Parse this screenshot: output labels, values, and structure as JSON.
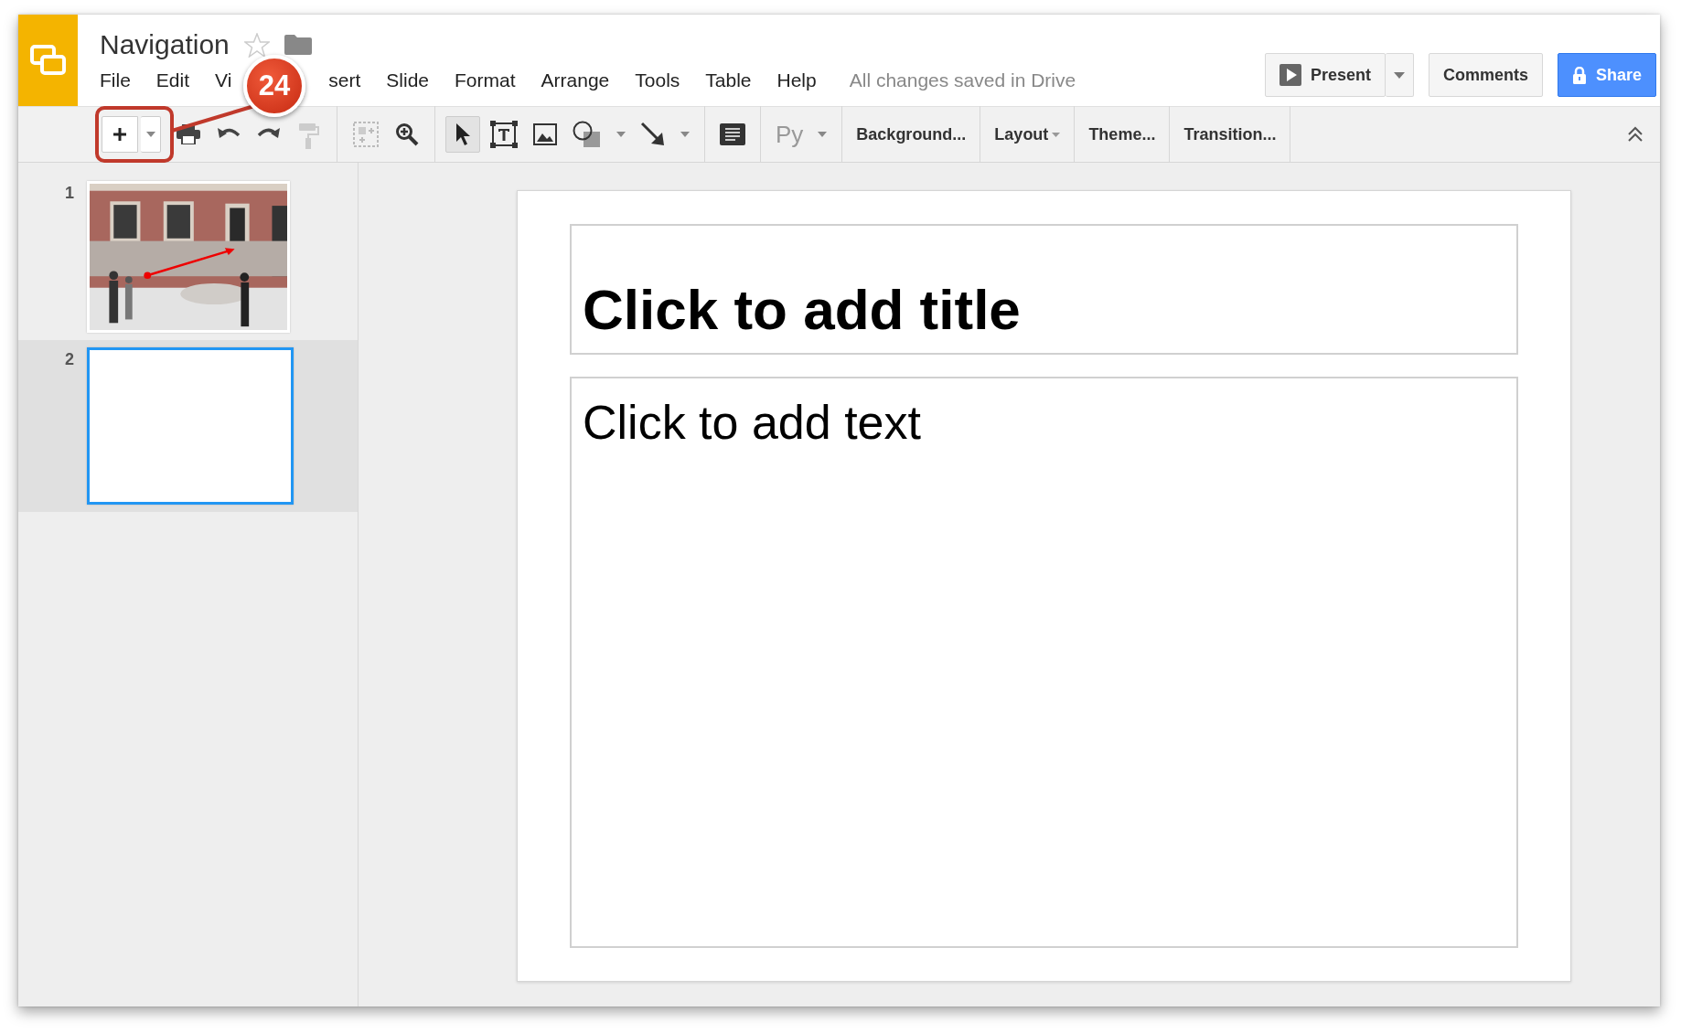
{
  "app": {
    "title": "Navigation"
  },
  "menu": [
    {
      "label": "File"
    },
    {
      "label": "Edit"
    },
    {
      "label": "Vi"
    },
    {
      "label": "sert"
    },
    {
      "label": "Slide"
    },
    {
      "label": "Format"
    },
    {
      "label": "Arrange"
    },
    {
      "label": "Tools"
    },
    {
      "label": "Table"
    },
    {
      "label": "Help"
    }
  ],
  "save_status": "All changes saved in Drive",
  "header_buttons": {
    "present": "Present",
    "comments": "Comments",
    "share": "Share"
  },
  "toolbar": {
    "input_tools": "Py",
    "text_buttons": [
      {
        "label": "Background...",
        "kind": "plain"
      },
      {
        "label": "Layout",
        "kind": "dropdown"
      },
      {
        "label": "Theme...",
        "kind": "plain"
      },
      {
        "label": "Transition...",
        "kind": "plain"
      }
    ]
  },
  "slides": [
    {
      "number": "1",
      "kind": "picture",
      "selected": false
    },
    {
      "number": "2",
      "kind": "blank",
      "selected": true
    }
  ],
  "canvas": {
    "title_placeholder": "Click to add title",
    "body_placeholder": "Click to add text"
  },
  "callout": {
    "number": "24"
  }
}
